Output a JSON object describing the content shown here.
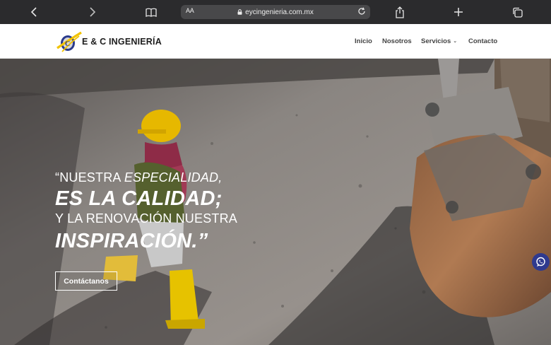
{
  "browser": {
    "url": "eycingenieria.com.mx",
    "text_size_label": "AA",
    "icons": [
      "back-icon",
      "forward-icon",
      "bookmarks-icon",
      "lock-icon",
      "reload-icon",
      "share-icon",
      "new-tab-icon",
      "tabs-icon"
    ]
  },
  "header": {
    "logo_text": "E & C INGENIERÍA",
    "nav": [
      {
        "label": "Inicio"
      },
      {
        "label": "Nosotros"
      },
      {
        "label": "Servicios",
        "has_dropdown": true
      },
      {
        "label": "Contacto"
      }
    ]
  },
  "hero": {
    "line1_a": "“NUESTRA ",
    "line1_b": "ESPECIALIDAD,",
    "line2": "ES LA CALIDAD;",
    "line3": "Y LA RENOVACIÓN NUESTRA",
    "line4": "INSPIRACIÓN.”",
    "cta_label": "Contáctanos"
  },
  "floating": {
    "icon": "whatsapp-icon"
  },
  "colors": {
    "logo_yellow": "#f2c300",
    "logo_blue": "#2a3a8c",
    "whatsapp_bg": "#2f3a8f"
  }
}
